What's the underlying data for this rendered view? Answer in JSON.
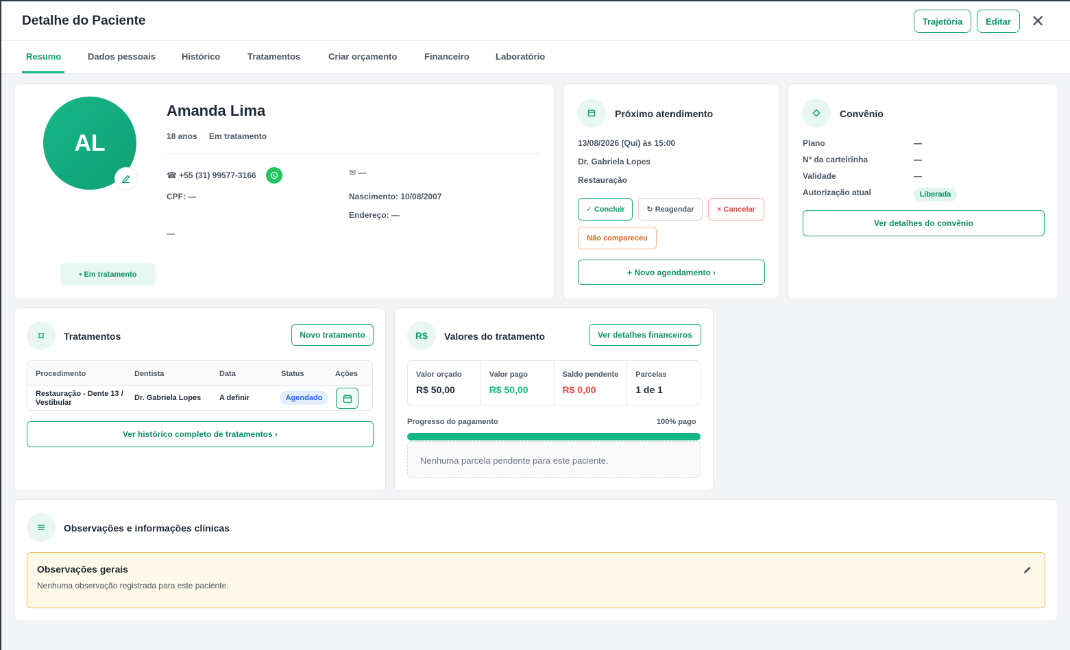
{
  "header": {
    "title": "Detalhe do Paciente",
    "trajetoria_label": "Trajetória",
    "editar_label": "Editar",
    "close_glyph": "✕"
  },
  "tabs": [
    {
      "label": "Resumo",
      "active": true
    },
    {
      "label": "Dados pessoais"
    },
    {
      "label": "Histórico"
    },
    {
      "label": "Tratamentos"
    },
    {
      "label": "Criar orçamento"
    },
    {
      "label": "Financeiro"
    },
    {
      "label": "Laboratório"
    }
  ],
  "patient": {
    "initials": "AL",
    "name": "Amanda Lima",
    "age": "18 anos",
    "status": "Em tratamento",
    "phone": "+55 (31) 99577-3166",
    "email": "—",
    "cpf": "CPF: —",
    "birth": "Nascimento: 10/08/2007",
    "address": "Endereço: —",
    "extra": "—",
    "status_badge": "• Em tratamento"
  },
  "next_appointment": {
    "title": "Próximo atendimento",
    "datetime": "13/08/2026 (Qui) às 15:00",
    "dentist": "Dr. Gabriela Lopes",
    "procedure": "Restauração",
    "concluir": "✓ Concluir",
    "reagendar": "↻ Reagendar",
    "cancelar": "× Cancelar",
    "nao_compareceu": "Não compareceu",
    "novo_agendamento": "+ Novo agendamento ›"
  },
  "convenio": {
    "title": "Convênio",
    "rows": [
      {
        "label": "Plano",
        "value": "—"
      },
      {
        "label": "Nº da carteirinha",
        "value": "—"
      },
      {
        "label": "Validade",
        "value": "—"
      },
      {
        "label": "Autorização atual",
        "value": "Liberada"
      }
    ],
    "ver_detalhes": "Ver detalhes do convênio"
  },
  "tratamentos": {
    "title": "Tratamentos",
    "novo_label": "Novo tratamento",
    "columns": [
      "Procedimento",
      "Dentista",
      "Data",
      "Status",
      "Ações"
    ],
    "rows": [
      {
        "procedimento_l1": "Restauração - Dente 13 /",
        "procedimento_l2": "Vestibular",
        "dentista": "Dr. Gabriela Lopes",
        "data": "A definir",
        "status": "Agendado"
      }
    ],
    "ver_historico": "Ver histórico completo de tratamentos ›"
  },
  "valores": {
    "title": "Valores do tratamento",
    "icon_text": "R$",
    "ver_detalhes": "Ver detalhes financeiros",
    "cells": [
      {
        "label": "Valor orçado",
        "value": "R$ 50,00"
      },
      {
        "label": "Valor pago",
        "value": "R$ 50,00"
      },
      {
        "label": "Saldo pendente",
        "value": "R$ 0,00"
      },
      {
        "label": "Parcelas",
        "value": "1 de 1"
      }
    ],
    "progress_label": "Progresso do pagamento",
    "progress_text": "100% pago",
    "progress_value": 1.0,
    "empty_msg": "Nenhuma parcela pendente para este paciente."
  },
  "observacoes": {
    "title": "Observações e informações clínicas",
    "box_title": "Observações gerais",
    "box_text": "Nenhuma observação registrada para este paciente."
  },
  "colors": {
    "accent": "#13b584",
    "paid_green": "#10b981",
    "pending_red": "#e04848",
    "cancel_red": "#e04848",
    "noshow_orange": "#d9641c",
    "badge_blue": "#2563eb"
  }
}
